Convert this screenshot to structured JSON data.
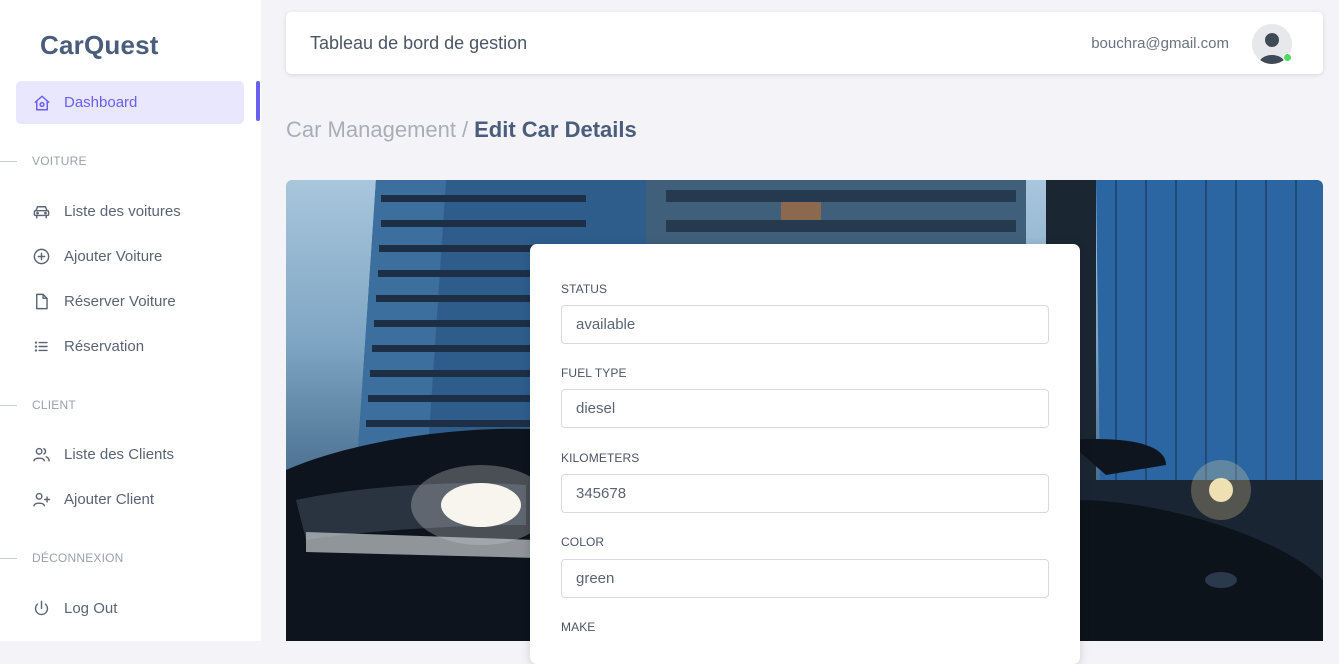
{
  "brand": {
    "name": "CarQuest"
  },
  "sidebar": {
    "active": {
      "label": "Dashboard",
      "icon": "home-icon"
    },
    "sections": [
      {
        "title": "VOITURE",
        "items": [
          {
            "label": "Liste des voitures",
            "icon": "car-icon"
          },
          {
            "label": "Ajouter Voiture",
            "icon": "plus-circle-icon"
          },
          {
            "label": "Réserver Voiture",
            "icon": "file-icon"
          },
          {
            "label": "Réservation",
            "icon": "list-icon"
          }
        ]
      },
      {
        "title": "CLIENT",
        "items": [
          {
            "label": "Liste des Clients",
            "icon": "users-icon"
          },
          {
            "label": "Ajouter Client",
            "icon": "user-plus-icon"
          }
        ]
      },
      {
        "title": "DÉCONNEXION",
        "items": [
          {
            "label": "Log Out",
            "icon": "power-icon"
          }
        ]
      }
    ]
  },
  "header": {
    "title": "Tableau de bord de gestion",
    "email": "bouchra@gmail.com",
    "avatar_icon": "user-avatar-icon",
    "status_color": "#4cd964"
  },
  "breadcrumb": {
    "parent": "Car Management",
    "separator": "/",
    "current": "Edit Car Details"
  },
  "form": {
    "fields": [
      {
        "label": "STATUS",
        "value": "available"
      },
      {
        "label": "FUEL TYPE",
        "value": "diesel"
      },
      {
        "label": "KILOMETERS",
        "value": "345678"
      },
      {
        "label": "COLOR",
        "value": "green"
      },
      {
        "label": "MAKE",
        "value": ""
      }
    ]
  },
  "colors": {
    "accent": "#6a5ff0",
    "accent_bg": "#e8e7fd",
    "brand_text": "#4a5d7a"
  }
}
